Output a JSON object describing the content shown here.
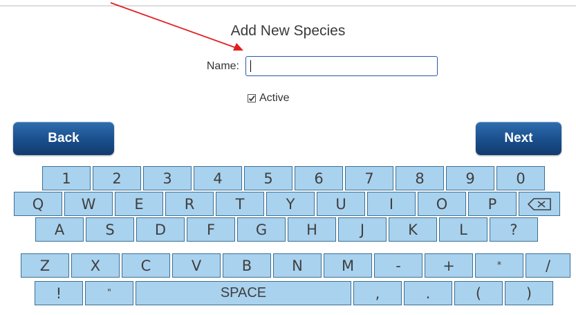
{
  "page": {
    "title": "Add New Species",
    "name_label": "Name:",
    "name_value": "",
    "active_label": "Active",
    "active_checked": true
  },
  "nav": {
    "back_label": "Back",
    "next_label": "Next",
    "button_color": "#1a4e8c"
  },
  "keyboard": {
    "key_color": "#a9d2ee",
    "rows": [
      [
        "1",
        "2",
        "3",
        "4",
        "5",
        "6",
        "7",
        "8",
        "9",
        "0"
      ],
      [
        "Q",
        "W",
        "E",
        "R",
        "T",
        "Y",
        "U",
        "I",
        "O",
        "P",
        "⌫"
      ],
      [
        "A",
        "S",
        "D",
        "F",
        "G",
        "H",
        "J",
        "K",
        "L",
        "?"
      ],
      [
        "Z",
        "X",
        "C",
        "V",
        "B",
        "N",
        "M",
        "-",
        "+",
        "*",
        "/"
      ],
      [
        "!",
        "\"",
        "SPACE",
        ",",
        ".",
        "(",
        ")"
      ]
    ]
  },
  "annotation": {
    "arrow_color": "#e02020"
  }
}
